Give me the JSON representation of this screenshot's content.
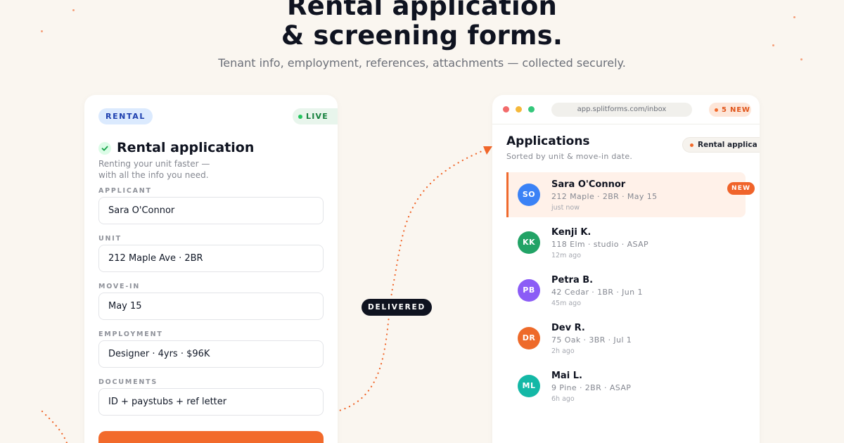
{
  "hero": {
    "headline_line1": "Rental application",
    "headline_line2": "& screening forms.",
    "subtitle": "Tenant info, employment, references, attachments — collected securely."
  },
  "form": {
    "badge": "RENTAL",
    "status": "LIVE",
    "title": "Rental application",
    "description_line1": "Renting your unit faster —",
    "description_line2": "with all the info you need.",
    "fields": [
      {
        "label": "APPLICANT",
        "value": "Sara O'Connor"
      },
      {
        "label": "UNIT",
        "value": "212 Maple Ave · 2BR"
      },
      {
        "label": "MOVE-IN",
        "value": "May 15"
      },
      {
        "label": "EMPLOYMENT",
        "value": "Designer · 4yrs · $96K"
      },
      {
        "label": "DOCUMENTS",
        "value": "ID + paystubs + ref letter"
      }
    ]
  },
  "connector": {
    "label": "DELIVERED"
  },
  "inbox": {
    "url": "app.splitforms.com/inbox",
    "new_count": "5 NEW",
    "title": "Applications",
    "subtitle": "Sorted by unit & move-in date.",
    "filter": "Rental applica",
    "items": [
      {
        "initials": "SO",
        "name": "Sara O'Connor",
        "detail": "212 Maple · 2BR · May 15",
        "time": "just now",
        "badge": "NEW",
        "color": "#3b82f6"
      },
      {
        "initials": "KK",
        "name": "Kenji K.",
        "detail": "118 Elm · studio · ASAP",
        "time": "12m ago",
        "color": "#22a366"
      },
      {
        "initials": "PB",
        "name": "Petra B.",
        "detail": "42 Cedar · 1BR · Jun 1",
        "time": "45m ago",
        "color": "#8b5cf6"
      },
      {
        "initials": "DR",
        "name": "Dev R.",
        "detail": "75 Oak · 3BR · Jul 1",
        "time": "2h ago",
        "color": "#ee6a2a"
      },
      {
        "initials": "ML",
        "name": "Mai L.",
        "detail": "9 Pine · 2BR · ASAP",
        "time": "6h ago",
        "color": "#14b8a6"
      }
    ]
  },
  "colors": {
    "accent": "#f26a2b",
    "background": "#faf6f0",
    "live": "#22c55e",
    "badge_blue": "#dbeafe"
  },
  "icons": {
    "check": "check-icon"
  }
}
